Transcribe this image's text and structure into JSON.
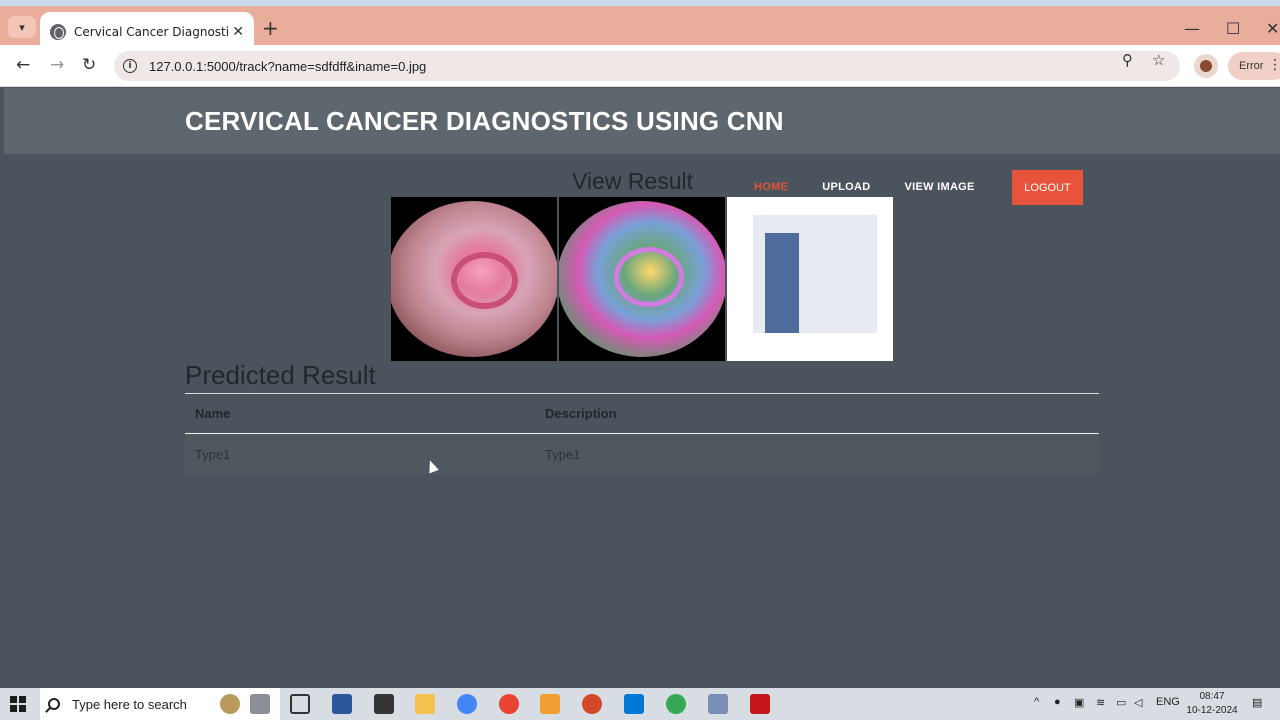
{
  "browser": {
    "tab_title": "Cervical Cancer Diagnostics Usi",
    "url": "127.0.0.1:5000/track?name=sdfdff&iname=0.jpg",
    "error_label": "Error"
  },
  "site": {
    "title": "CERVICAL CANCER DIAGNOSTICS USING CNN"
  },
  "nav": {
    "home": "HOME",
    "upload": "UPLOAD",
    "view_image": "VIEW IMAGE",
    "logout": "LOGOUT"
  },
  "section": {
    "view_result": "View Result",
    "predicted_result": "Predicted Result"
  },
  "table": {
    "headers": [
      "Name",
      "Description"
    ],
    "rows": [
      [
        "Type1",
        "Type1"
      ]
    ]
  },
  "taskbar": {
    "search_placeholder": "Type here to search",
    "language": "ENG",
    "time": "08:47",
    "date": "10-12-2024"
  },
  "colors": {
    "accent": "#e8543b",
    "page_bg": "#4b535c",
    "header_bg": "#5e666e"
  }
}
